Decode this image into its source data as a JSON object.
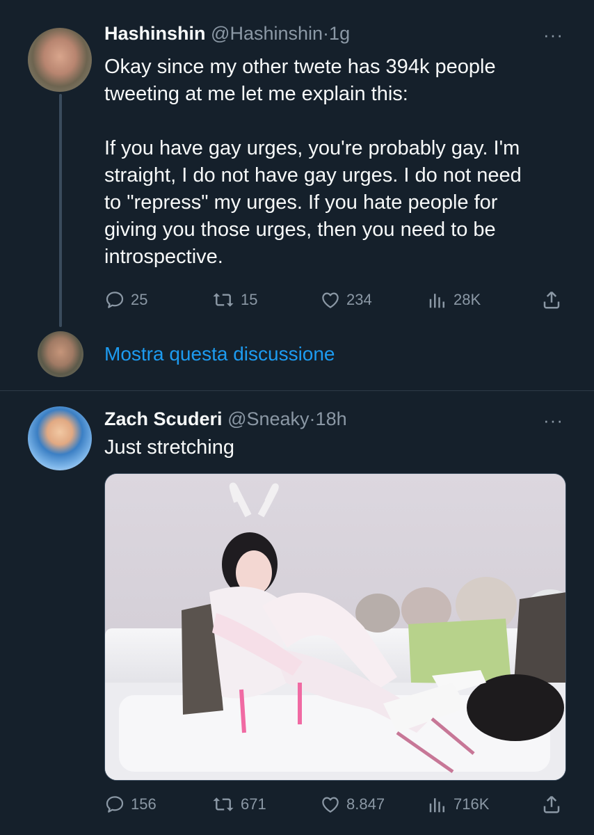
{
  "tweet1": {
    "name": "Hashinshin",
    "handle": "@Hashinshin",
    "separator": "·",
    "time": "1g",
    "more": "···",
    "text": "Okay since my other twete has 394k people\ntweeting at me let me explain this:\n\nIf you have gay urges, you're probably gay. I'm\nstraight, I do not have gay urges. I do not need\nto \"repress\" my urges. If you hate people for\ngiving you those urges, then you need to be\nintrospective.",
    "replies": "25",
    "retweets": "15",
    "likes": "234",
    "views": "28K"
  },
  "show_thread": "Mostra questa discussione",
  "tweet2": {
    "name": "Zach Scuderi",
    "handle": "@Sneaky",
    "separator": "·",
    "time": "18h",
    "more": "···",
    "text": "Just stretching",
    "replies": "156",
    "retweets": "671",
    "likes": "8.847",
    "views": "716K"
  },
  "colors": {
    "background": "#15202b",
    "text": "#f7f9f9",
    "muted": "#8b98a5",
    "link": "#1d9bf0",
    "divider": "#2f3b47"
  },
  "icons": [
    "reply-icon",
    "retweet-icon",
    "like-icon",
    "views-icon",
    "share-icon",
    "more-icon"
  ]
}
